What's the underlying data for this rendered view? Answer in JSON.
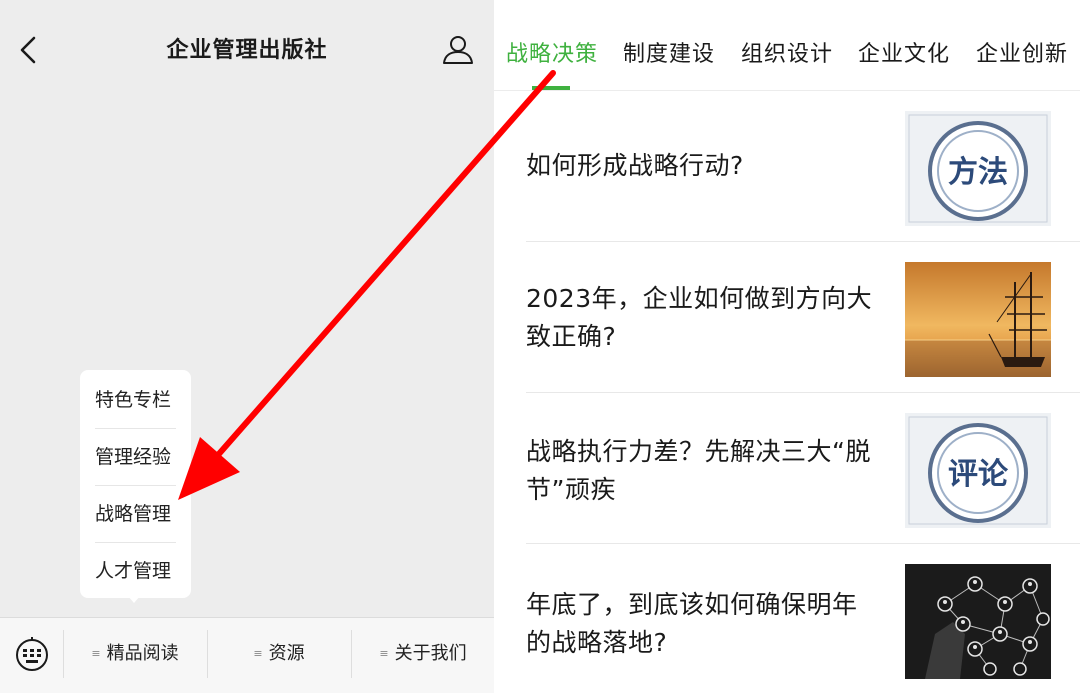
{
  "header": {
    "title": "企业管理出版社"
  },
  "popup_menu": {
    "items": [
      "特色专栏",
      "管理经验",
      "战略管理",
      "人才管理"
    ]
  },
  "bottom_menu": {
    "items": [
      "精品阅读",
      "资源",
      "关于我们"
    ]
  },
  "tabs": {
    "items": [
      "战略决策",
      "制度建设",
      "组织设计",
      "企业文化",
      "企业创新"
    ],
    "active_index": 0
  },
  "articles": [
    {
      "title": "如何形成战略行动?",
      "thumbnail_text": "方法"
    },
    {
      "title": "2023年，企业如何做到方向大致正确?",
      "thumbnail_text": ""
    },
    {
      "title": "战略执行力差？先解决三大“脱节”顽疾",
      "thumbnail_text": "评论"
    },
    {
      "title": "年底了，到底该如何确保明年的战略落地?",
      "thumbnail_text": ""
    }
  ],
  "colors": {
    "accent": "#3fb13f",
    "annotation_arrow": "#ff0000"
  }
}
